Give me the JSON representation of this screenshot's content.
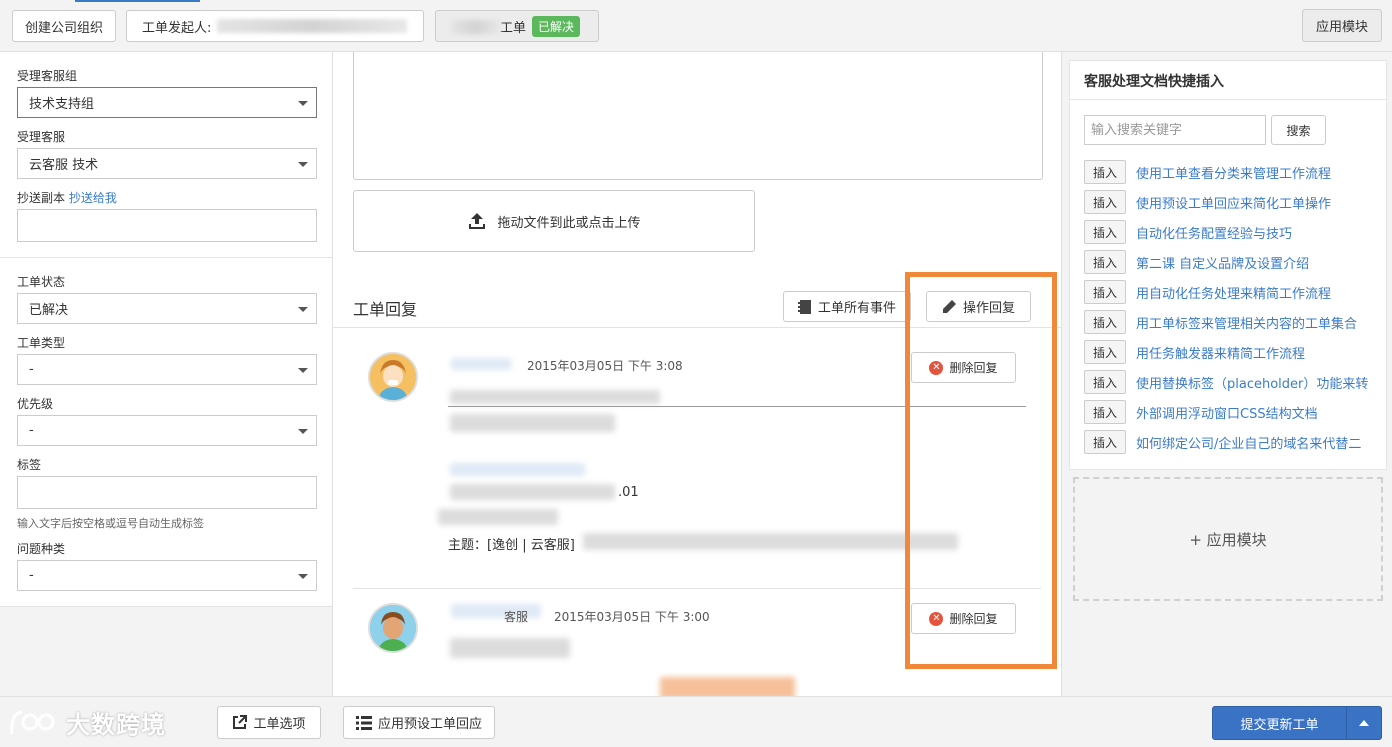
{
  "topbar": {
    "create_org": "创建公司组织",
    "requester_label": "工单发起人:",
    "ticket_label": "工单",
    "status_badge": "已解决",
    "app_module": "应用模块"
  },
  "left": {
    "group_label": "受理客服组",
    "group_value": "技术支持组",
    "agent_label": "受理客服",
    "agent_value": "云客服 技术",
    "cc_label": "抄送副本",
    "cc_link": "抄送给我",
    "status_label": "工单状态",
    "status_value": "已解决",
    "type_label": "工单类型",
    "type_value": "-",
    "priority_label": "优先级",
    "priority_value": "-",
    "tags_label": "标签",
    "tags_hint": "输入文字后按空格或逗号自动生成标签",
    "category_label": "问题种类",
    "category_value": "-"
  },
  "center": {
    "upload_text": "拖动文件到此或点击上传",
    "replies_title": "工单回复",
    "all_events": "工单所有事件",
    "action_reply": "操作回复",
    "replies": [
      {
        "timestamp": "2015年03月05日 下午 3:08",
        "delete_label": "删除回复",
        "partial_text": ".01",
        "subject_prefix": "主题：[逸创 | 云客服]"
      },
      {
        "author_suffix": "客服",
        "timestamp": "2015年03月05日 下午 3:00",
        "delete_label": "删除回复"
      }
    ]
  },
  "right": {
    "title": "客服处理文档快捷插入",
    "search_placeholder": "输入搜索关键字",
    "search_button": "搜索",
    "insert_label": "插入",
    "docs": [
      "使用工单查看分类来管理工作流程",
      "使用预设工单回应来简化工单操作",
      "自动化任务配置经验与技巧",
      "第二课 自定义品牌及设置介绍",
      "用自动化任务处理来精简工作流程",
      "用工单标签来管理相关内容的工单集合",
      "用任务触发器来精简工作流程",
      "使用替换标签（placeholder）功能来转",
      "外部调用浮动窗口CSS结构文档",
      "如何绑定公司/企业自己的域名来代替二"
    ],
    "app_module": "+ 应用模块"
  },
  "bottom": {
    "watermark": "大数跨境",
    "ticket_options": "工单选项",
    "apply_preset": "应用预设工单回应",
    "submit": "提交更新工单"
  },
  "colors": {
    "accent": "#3a7bc8",
    "success": "#5cb85c",
    "highlight": "#f0883a",
    "danger": "#e5533d",
    "submit": "#3a73c4"
  }
}
